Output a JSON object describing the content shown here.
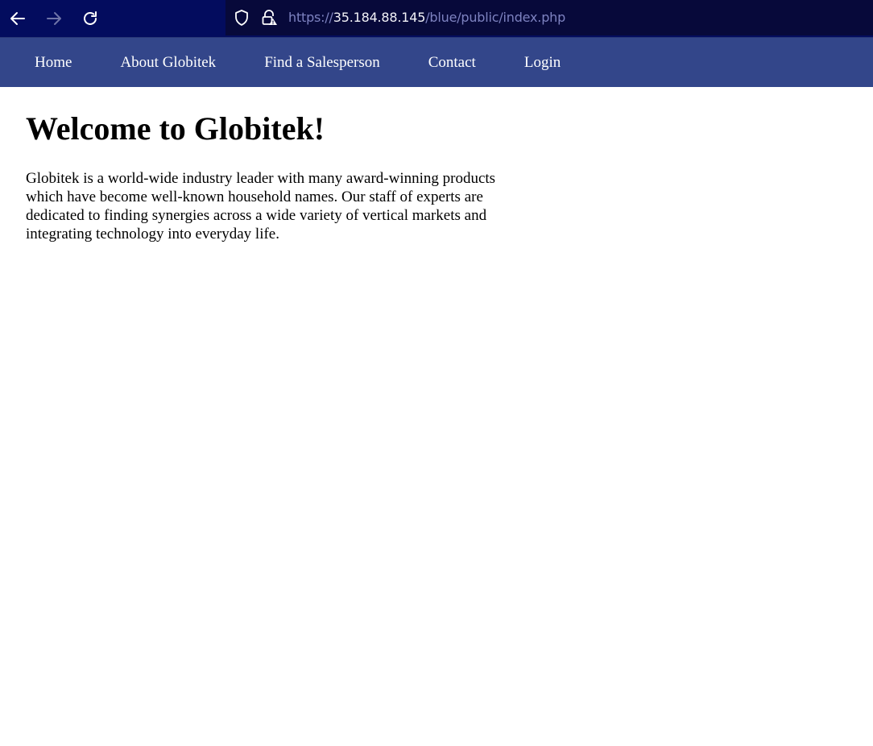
{
  "browser": {
    "url": {
      "scheme": "https://",
      "host": "35.184.88.145",
      "path": "/blue/public/index.php"
    },
    "icons": {
      "back": "arrow-left-icon",
      "forward": "arrow-right-icon",
      "reload": "reload-icon",
      "tracking": "shield-icon",
      "security": "lock-warning-icon"
    }
  },
  "nav": {
    "items": [
      {
        "label": "Home"
      },
      {
        "label": "About Globitek"
      },
      {
        "label": "Find a Salesperson"
      },
      {
        "label": "Contact"
      },
      {
        "label": "Login"
      }
    ]
  },
  "main": {
    "heading": "Welcome to Globitek!",
    "intro": "Globitek is a world-wide industry leader with many award-winning products which have become well-known household names. Our staff of experts are dedicated to finding synergies across a wide variety of vertical markets and integrating technology into everyday life."
  },
  "colors": {
    "browser_bar": "#030c5e",
    "url_field": "#07093a",
    "site_nav": "#33468a",
    "text": "#000000"
  }
}
